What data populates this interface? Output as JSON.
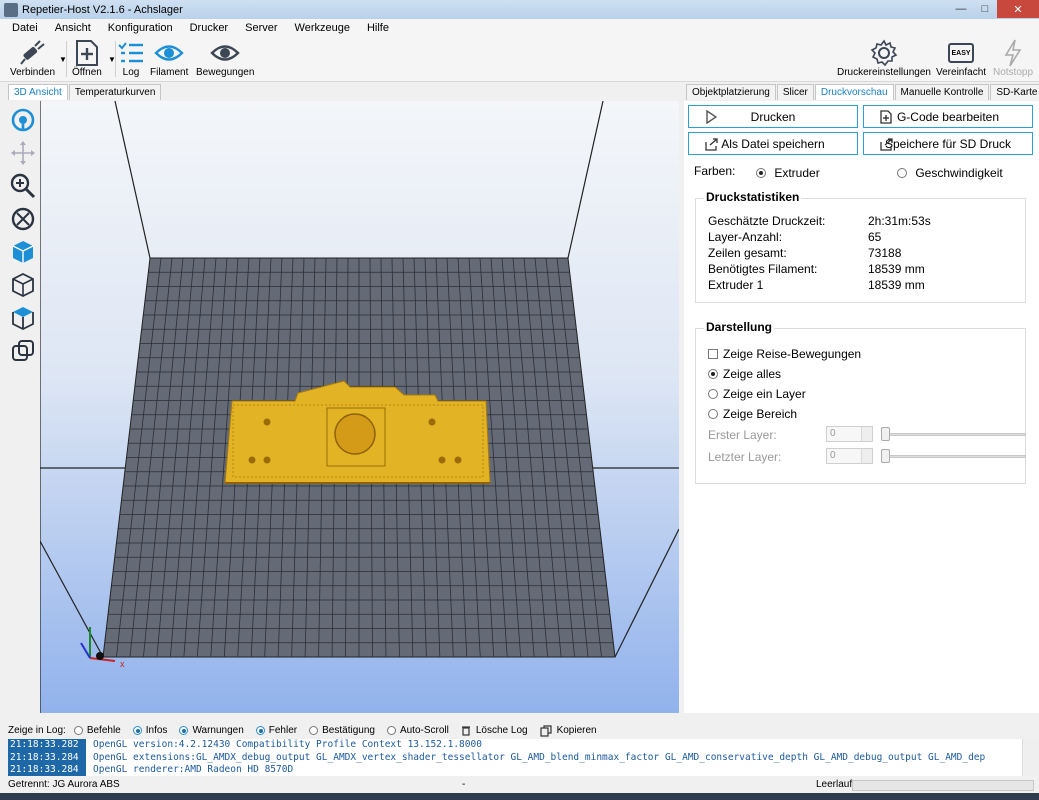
{
  "window": {
    "title": "Repetier-Host V2.1.6 - Achslager"
  },
  "menu": [
    "Datei",
    "Ansicht",
    "Konfiguration",
    "Drucker",
    "Server",
    "Werkzeuge",
    "Hilfe"
  ],
  "toolbar": {
    "connect": "Verbinden",
    "open": "Öffnen",
    "log": "Log",
    "filament": "Filament",
    "moves": "Bewegungen",
    "printer_settings": "Druckereinstellungen",
    "simplified": "Vereinfacht",
    "emergency_stop": "Notstopp",
    "easy_badge": "EASY"
  },
  "left_tabs": [
    "3D Ansicht",
    "Temperaturkurven"
  ],
  "right_tabs": [
    "Objektplatzierung",
    "Slicer",
    "Druckvorschau",
    "Manuelle Kontrolle",
    "SD-Karte"
  ],
  "preview": {
    "print_button": "Drucken",
    "edit_gcode_button": "G-Code bearbeiten",
    "save_file_button": "Als Datei speichern",
    "save_sd_button": "Speichere für SD Druck",
    "colors_label": "Farben:",
    "color_extruder": "Extruder",
    "color_speed": "Geschwindigkeit",
    "selected_color_mode": "Extruder"
  },
  "stats": {
    "title": "Druckstatistiken",
    "rows": [
      {
        "label": "Geschätzte Druckzeit:",
        "value": "2h:31m:53s"
      },
      {
        "label": "Layer-Anzahl:",
        "value": "65"
      },
      {
        "label": "Zeilen gesamt:",
        "value": "73188"
      },
      {
        "label": "Benötigtes Filament:",
        "value": "18539 mm"
      },
      {
        "label": "Extruder 1",
        "value": "18539 mm"
      }
    ]
  },
  "display": {
    "title": "Darstellung",
    "show_travel": "Zeige Reise-Bewegungen",
    "show_all": "Zeige alles",
    "show_layer": "Zeige ein Layer",
    "show_range": "Zeige Bereich",
    "first_layer_label": "Erster Layer:",
    "last_layer_label": "Letzter Layer:",
    "first_layer_value": "0",
    "last_layer_value": "0",
    "selected": "Zeige alles"
  },
  "log": {
    "label": "Zeige in Log:",
    "filters": [
      "Befehle",
      "Infos",
      "Warnungen",
      "Fehler",
      "Bestätigung",
      "Auto-Scroll"
    ],
    "clear": "Lösche Log",
    "copy": "Kopieren",
    "lines": [
      {
        "time": "21:18:33.282",
        "text": "OpenGL version:4.2.12430 Compatibility Profile Context 13.152.1.8000"
      },
      {
        "time": "21:18:33.284",
        "text": "OpenGL extensions:GL_AMDX_debug_output GL_AMDX_vertex_shader_tessellator GL_AMD_blend_minmax_factor GL_AMD_conservative_depth GL_AMD_debug_output GL_AMD_dep"
      },
      {
        "time": "21:18:33.284",
        "text": "OpenGL renderer:AMD Radeon HD 8570D"
      }
    ]
  },
  "status": {
    "connection": "Getrennt: JG Aurora ABS",
    "middle": "-",
    "state": "Leerlauf"
  }
}
